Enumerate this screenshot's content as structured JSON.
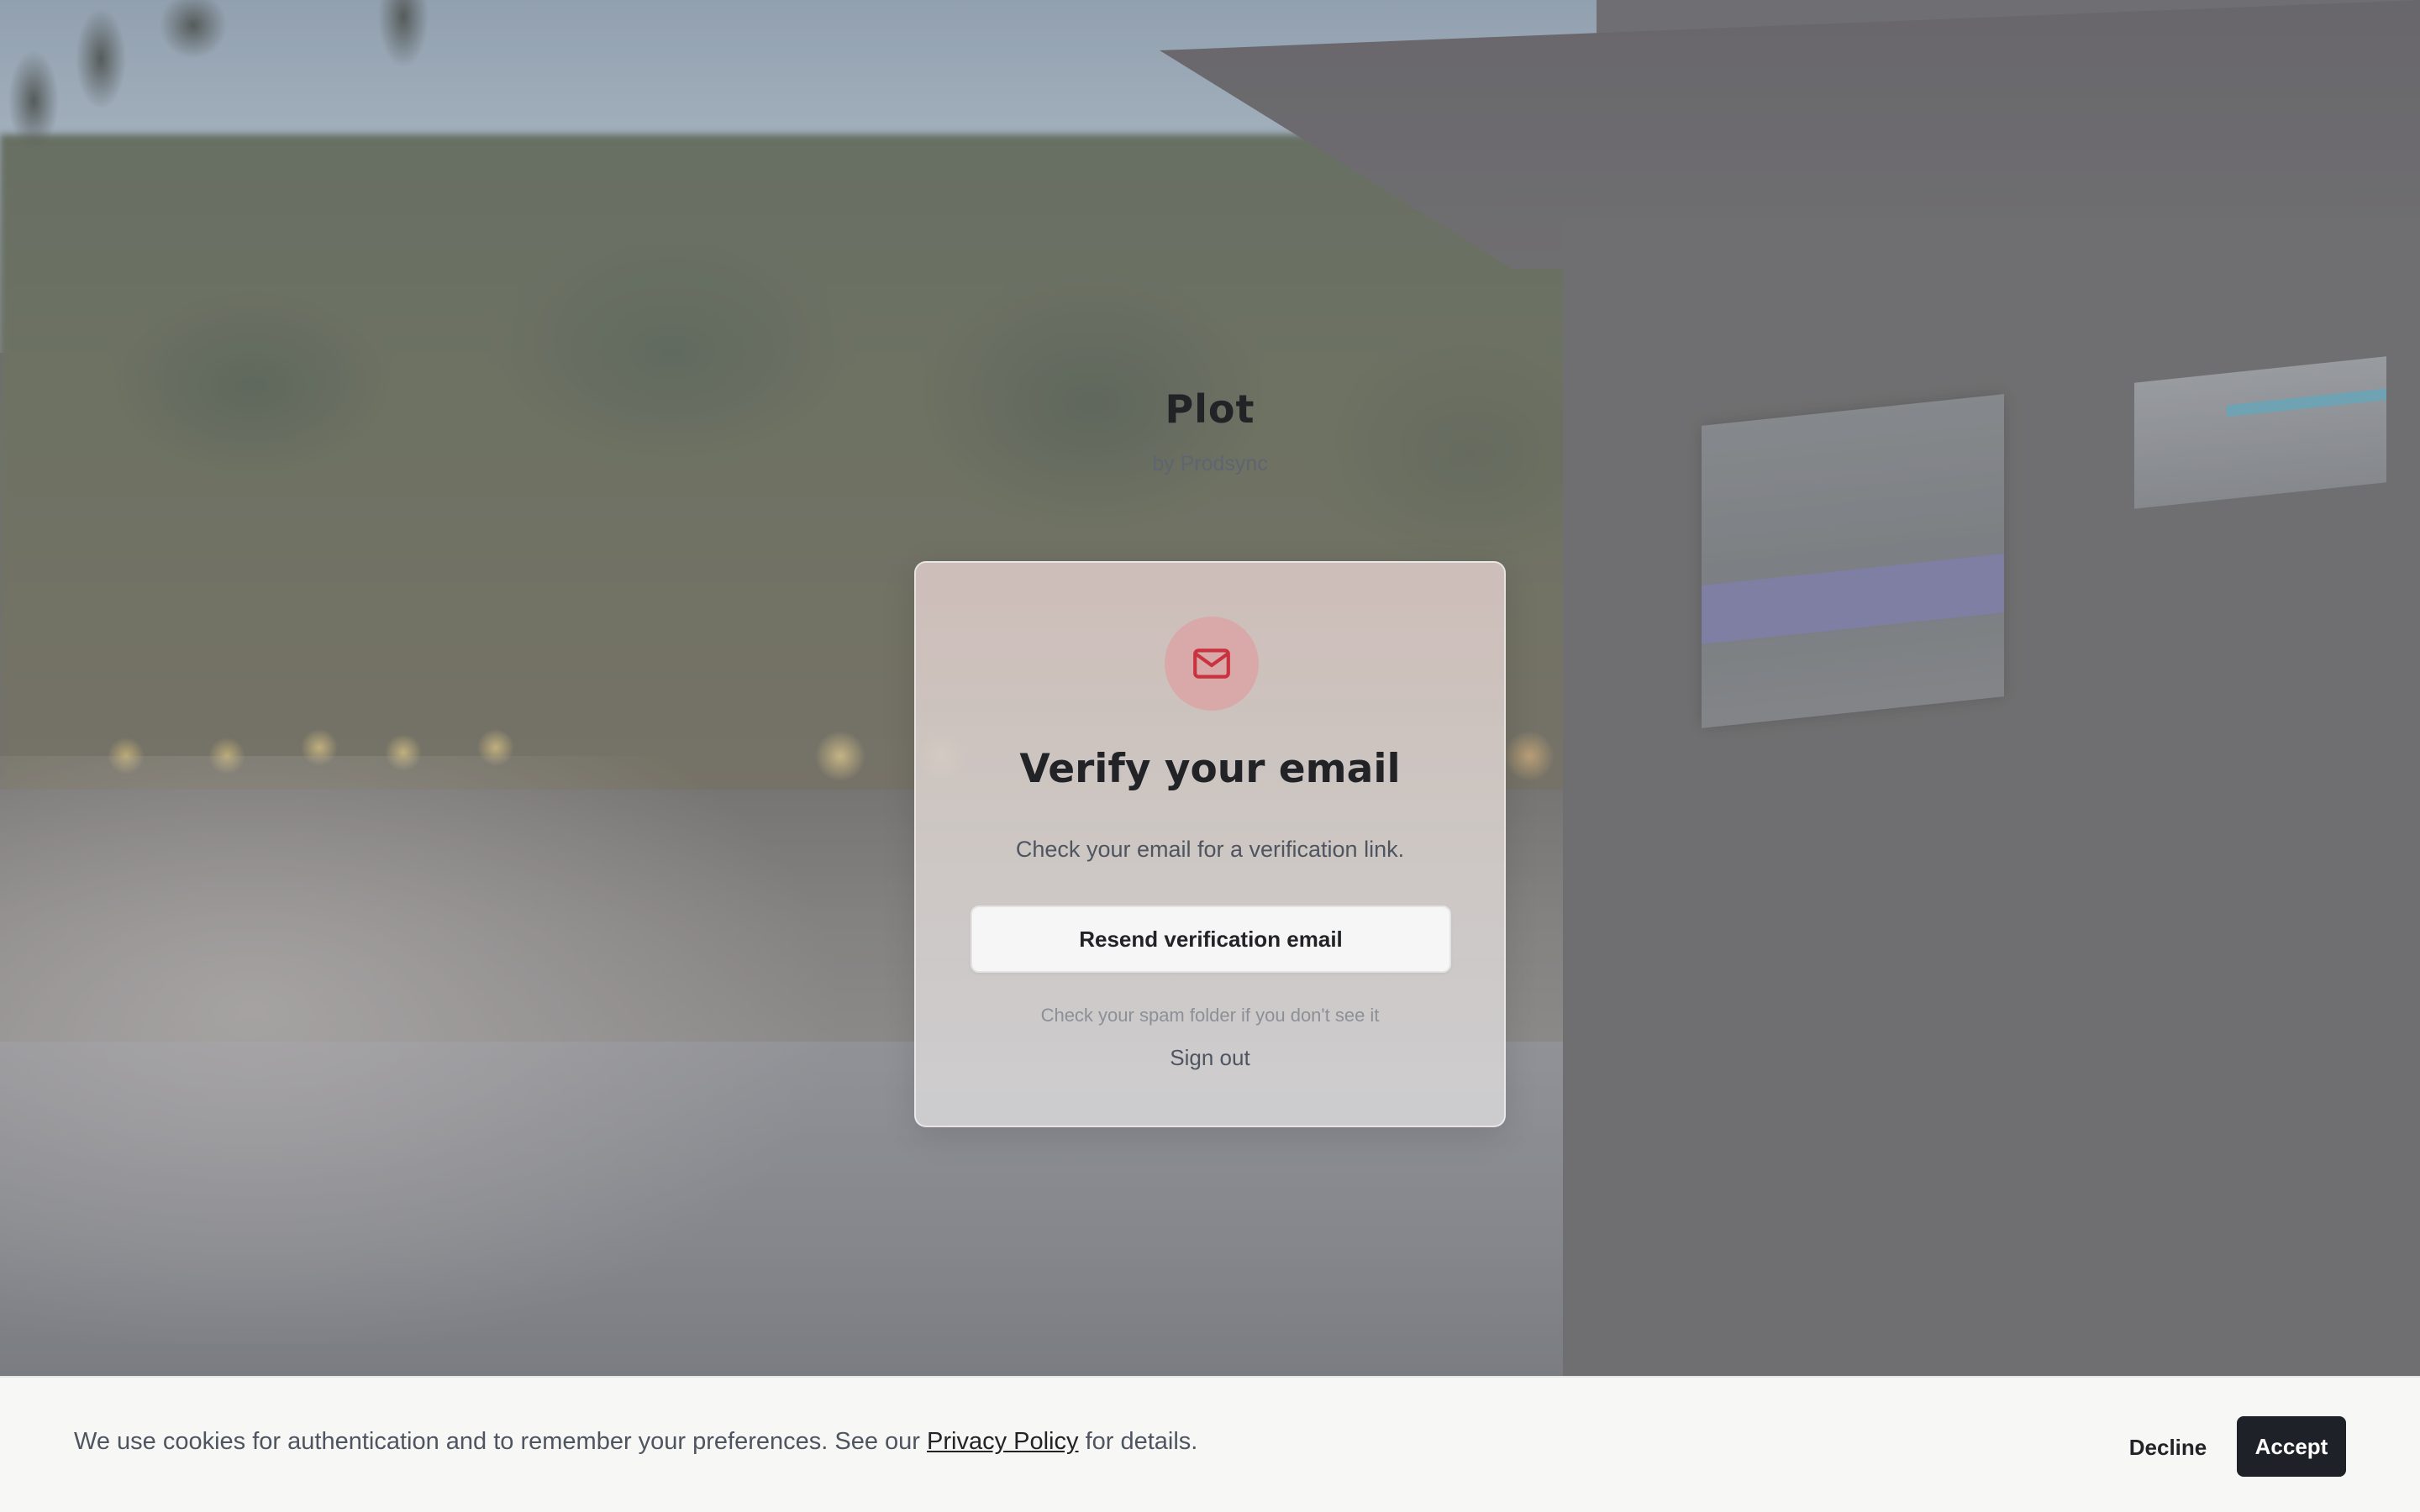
{
  "brand": {
    "title": "Plot",
    "subtitle": "by Prodsync"
  },
  "card": {
    "icon": "mail-icon",
    "title": "Verify your email",
    "description": "Check your email for a verification link.",
    "resend_label": "Resend verification email",
    "hint": "Check your spam folder if you don't see it",
    "signout_label": "Sign out"
  },
  "cookie_banner": {
    "text_before": "We use cookies for authentication and to remember your preferences. See our ",
    "link_label": "Privacy Policy",
    "text_after": " for details.",
    "decline_label": "Decline",
    "accept_label": "Accept"
  },
  "colors": {
    "accent": "#c8333f",
    "icon_bg": "#d9a8a8",
    "primary_dark": "#1f2128",
    "text_dark": "#222327",
    "text_muted": "#4f5560"
  }
}
